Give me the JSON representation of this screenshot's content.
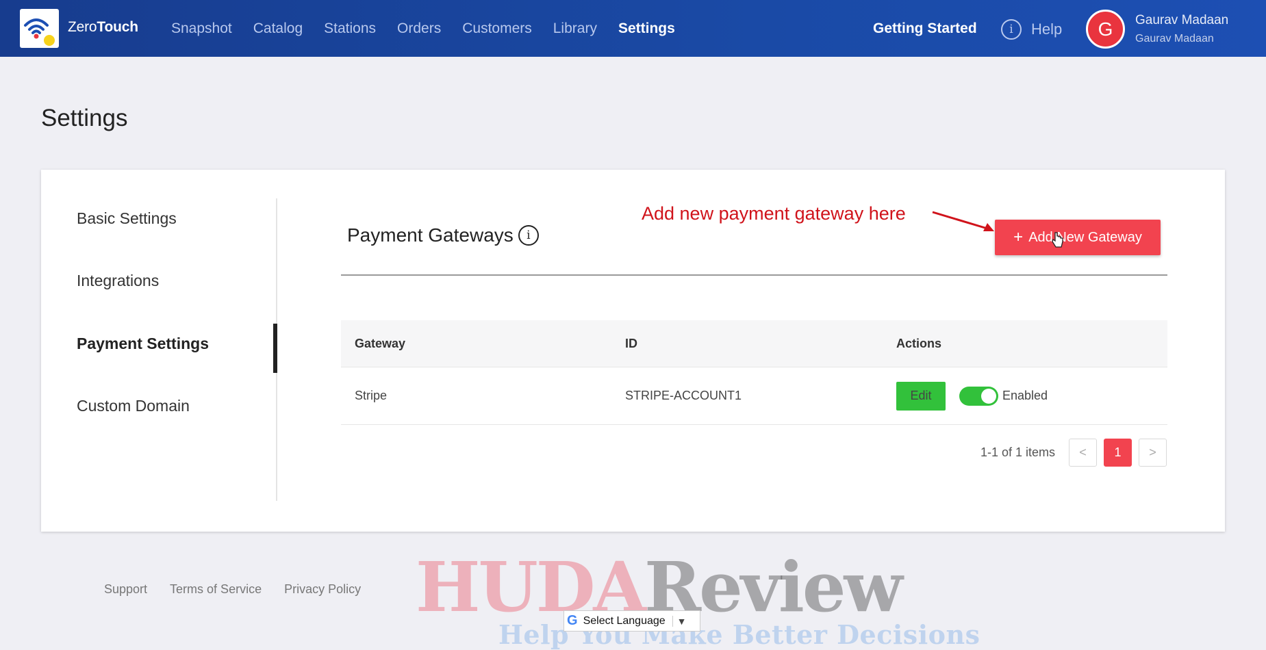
{
  "app": {
    "logo_prefix": "Zero",
    "logo_suffix": "Touch"
  },
  "nav": {
    "items": [
      {
        "label": "Snapshot"
      },
      {
        "label": "Catalog"
      },
      {
        "label": "Stations"
      },
      {
        "label": "Orders"
      },
      {
        "label": "Customers"
      },
      {
        "label": "Library"
      },
      {
        "label": "Settings",
        "active": true
      }
    ],
    "getting_started": "Getting Started",
    "help": "Help"
  },
  "user": {
    "initial": "G",
    "name": "Gaurav Madaan",
    "sub": "Gaurav Madaan"
  },
  "page": {
    "title": "Settings"
  },
  "side_menu": [
    {
      "label": "Basic Settings"
    },
    {
      "label": "Integrations"
    },
    {
      "label": "Payment Settings",
      "active": true
    },
    {
      "label": "Custom Domain"
    }
  ],
  "section": {
    "title": "Payment Gateways",
    "annotation": "Add new payment gateway here",
    "add_button": "Add New Gateway"
  },
  "table": {
    "headers": [
      "Gateway",
      "ID",
      "Actions"
    ],
    "rows": [
      {
        "gateway": "Stripe",
        "id": "STRIPE-ACCOUNT1",
        "edit_label": "Edit",
        "status_label": "Enabled",
        "enabled": true
      }
    ]
  },
  "pagination": {
    "summary": "1-1 of 1 items",
    "prev": "<",
    "current": "1",
    "next": ">"
  },
  "footer": {
    "links": [
      "Support",
      "Terms of Service",
      "Privacy Policy"
    ]
  },
  "language": {
    "label": "Select Language"
  },
  "watermark": {
    "part1": "HUDA",
    "part2": "Review",
    "tagline": "Help You Make Better Decisions"
  },
  "colors": {
    "nav_bg": "#1a4aa6",
    "accent": "#f2434f",
    "success": "#32c13b",
    "annotation": "#d0131b"
  }
}
